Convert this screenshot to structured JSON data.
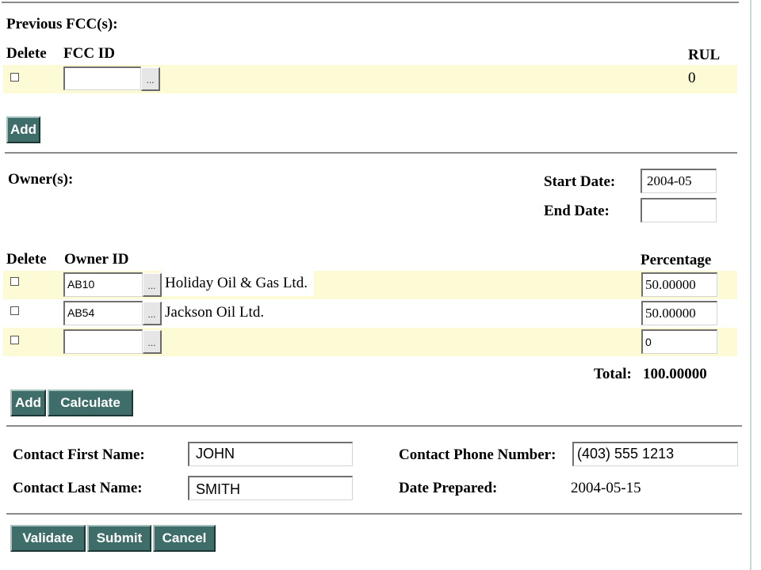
{
  "previous_fcc": {
    "heading": "Previous FCC(s):",
    "columns": {
      "delete": "Delete",
      "fcc_id": "FCC ID",
      "rul": "RUL"
    },
    "rows": [
      {
        "fcc_id": "",
        "rul": "0"
      }
    ],
    "add_label": "Add",
    "lookup_label": "..."
  },
  "owners": {
    "heading": "Owner(s):",
    "start_date_label": "Start Date:",
    "start_date_value": "2004-05",
    "end_date_label": "End Date:",
    "end_date_value": "",
    "columns": {
      "delete": "Delete",
      "owner_id": "Owner ID",
      "percentage": "Percentage"
    },
    "rows": [
      {
        "owner_id": "AB10",
        "name": "Holiday Oil & Gas Ltd.",
        "percentage": "50.00000"
      },
      {
        "owner_id": "AB54",
        "name": "Jackson Oil Ltd.",
        "percentage": "50.00000"
      },
      {
        "owner_id": "",
        "name": "",
        "percentage": "0"
      }
    ],
    "total_label": "Total:",
    "total_value": "100.00000",
    "add_label": "Add",
    "calculate_label": "Calculate",
    "lookup_label": "..."
  },
  "contact": {
    "first_name_label": "Contact First Name:",
    "first_name_value": "JOHN",
    "last_name_label": "Contact Last Name:",
    "last_name_value": "SMITH",
    "phone_label": "Contact Phone Number:",
    "phone_value": "(403) 555 1213",
    "date_prepared_label": "Date Prepared:",
    "date_prepared_value": "2004-05-15"
  },
  "actions": {
    "validate_label": "Validate",
    "submit_label": "Submit",
    "cancel_label": "Cancel"
  },
  "colors": {
    "band": "#fdfbd6",
    "button": "#3f6e6a",
    "rule": "#8a8a8a"
  }
}
